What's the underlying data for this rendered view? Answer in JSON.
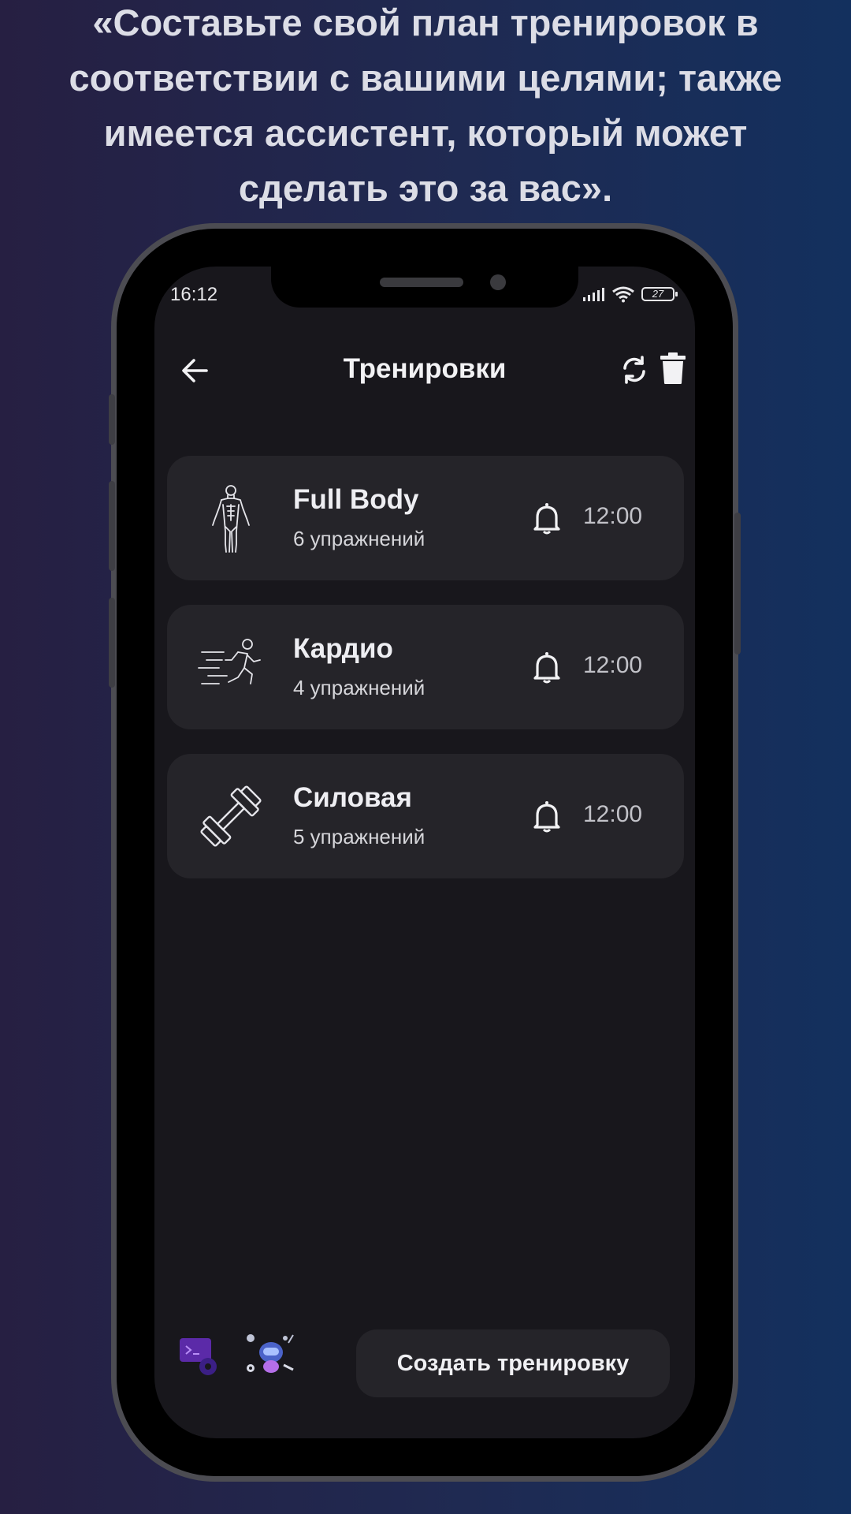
{
  "caption": "«Составьте свой план тренировок в соответствии с вашими целями; также имеется ассистент, который может сделать это за вас».",
  "status": {
    "time": "16:12",
    "battery": "27"
  },
  "header": {
    "title": "Тренировки",
    "icons": {
      "back": "arrow-left-icon",
      "sync": "sync-icon",
      "delete": "trash-icon"
    }
  },
  "workouts": [
    {
      "name": "Full Body",
      "count": "6 упражнений",
      "time": "12:00",
      "icon": "human-body-icon"
    },
    {
      "name": "Кардио",
      "count": "4 упражнений",
      "time": "12:00",
      "icon": "running-person-icon"
    },
    {
      "name": "Силовая",
      "count": "5 упражнений",
      "time": "12:00",
      "icon": "dumbbell-icon"
    }
  ],
  "bottom": {
    "create_label": "Создать тренировку",
    "icons": [
      "terminal-gear-icon",
      "robot-assistant-icon"
    ]
  },
  "colors": {
    "screen": "#18171c",
    "card": "#252429",
    "text": "#eeeef2",
    "accent": "#7b3fe4"
  }
}
